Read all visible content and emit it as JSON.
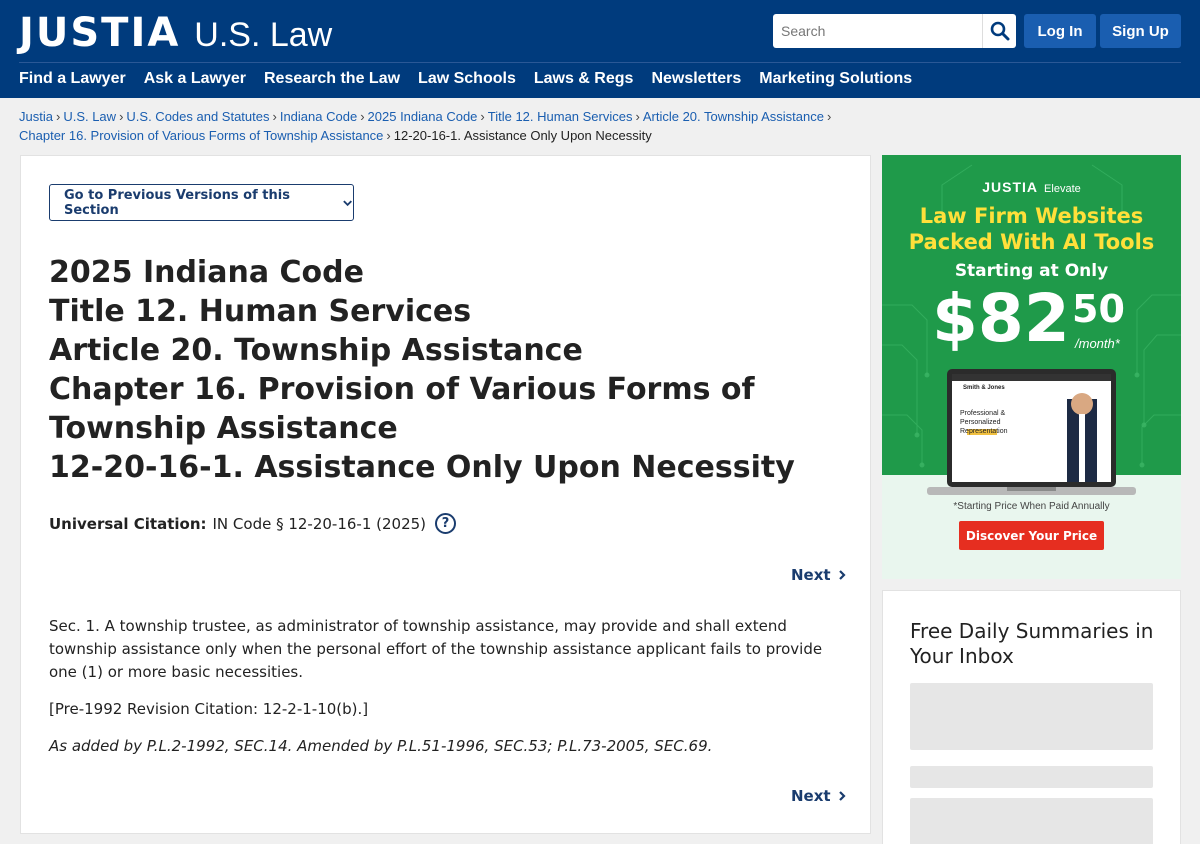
{
  "header": {
    "logo": "JUSTIA",
    "logo_sub": "U.S. Law",
    "search_placeholder": "Search",
    "login_label": "Log In",
    "signup_label": "Sign Up",
    "nav": [
      "Find a Lawyer",
      "Ask a Lawyer",
      "Research the Law",
      "Law Schools",
      "Laws & Regs",
      "Newsletters",
      "Marketing Solutions"
    ]
  },
  "breadcrumb": {
    "links": [
      "Justia",
      "U.S. Law",
      "U.S. Codes and Statutes",
      "Indiana Code",
      "2025 Indiana Code",
      "Title 12. Human Services",
      "Article 20. Township Assistance",
      "Chapter 16. Provision of Various Forms of Township Assistance"
    ],
    "current": "12-20-16-1. Assistance Only Upon Necessity",
    "separator": "›"
  },
  "main": {
    "prev_versions_label": "Go to Previous Versions of this Section",
    "title_lines": [
      "2025 Indiana Code",
      "Title 12. Human Services",
      "Article 20. Township Assistance",
      "Chapter 16. Provision of Various Forms of Township Assistance",
      "12-20-16-1. Assistance Only Upon Necessity"
    ],
    "citation_label": "Universal Citation:",
    "citation_value": "IN Code § 12-20-16-1 (2025)",
    "help_symbol": "?",
    "next_label": "Next",
    "body_paragraph": "Sec. 1. A township trustee, as administrator of township assistance, may provide and shall extend township assistance only when the personal effort of the township assistance applicant fails to provide one (1) or more basic necessities.",
    "revision_citation": "[Pre-1992 Revision Citation: 12-2-1-10(b).]",
    "history": "As added by P.L.2-1992, SEC.14. Amended by P.L.51-1996, SEC.53; P.L.73-2005, SEC.69."
  },
  "ad": {
    "brand": "JUSTIA",
    "brand_sub": "Elevate",
    "headline_1": "Law Firm Websites",
    "headline_2": "Packed With AI Tools",
    "starting": "Starting at Only",
    "price": "$82",
    "cents": "50",
    "per_month": "/month*",
    "laptop_firm": "Smith & Jones",
    "laptop_tagline": "Professional & Personalized Representation",
    "note": "*Starting Price When Paid Annually",
    "cta": "Discover Your Price",
    "colors": {
      "background": "#1f9a4a",
      "headline": "#ffe03a",
      "cta": "#e62e20"
    }
  },
  "newsletter": {
    "title": "Free Daily Summaries in Your Inbox"
  },
  "colors": {
    "header": "#003b7d",
    "link": "#1a5eb0",
    "button": "#1a5eb0",
    "text": "#222222"
  }
}
